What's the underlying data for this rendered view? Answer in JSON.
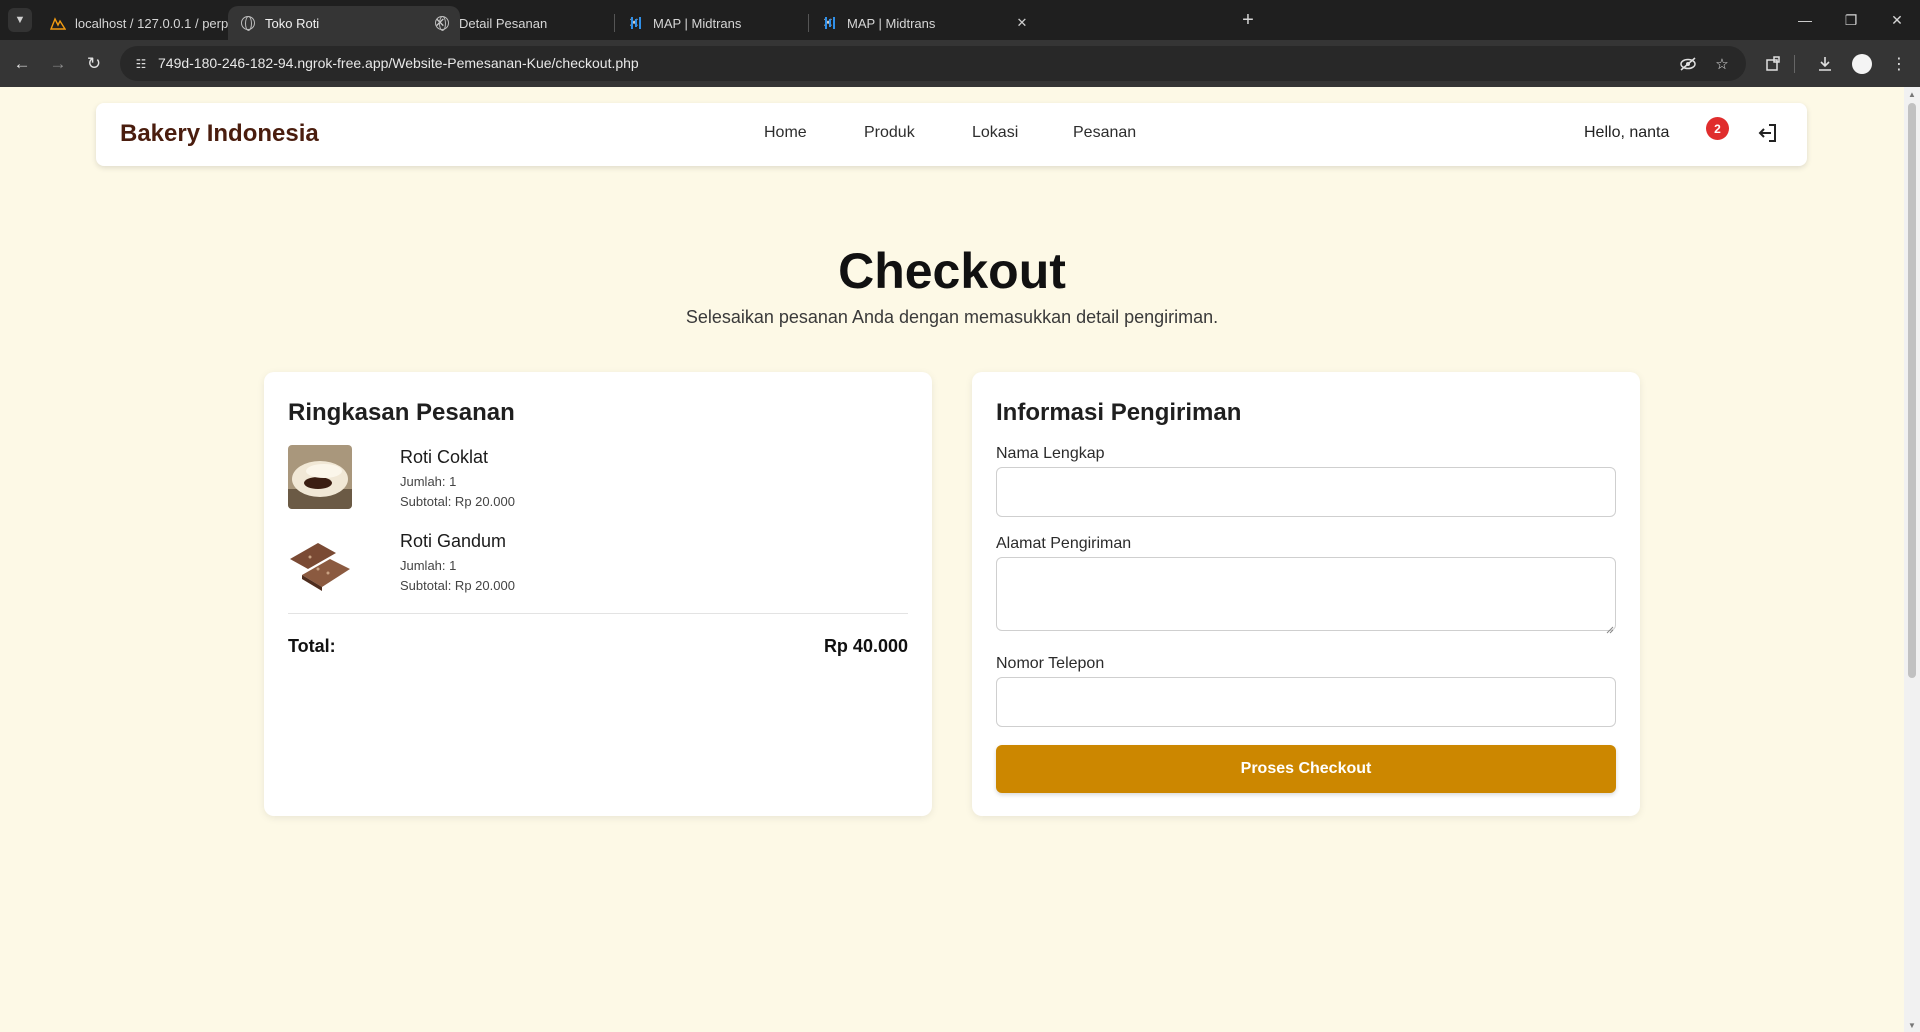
{
  "browser": {
    "tabs": [
      {
        "title": "localhost / 127.0.0.1 / perpustakaan",
        "icon": "phpmyadmin-icon",
        "active": false
      },
      {
        "title": "Toko Roti",
        "icon": "globe-icon",
        "active": true
      },
      {
        "title": "Detail Pesanan",
        "icon": "globe-icon",
        "active": false
      },
      {
        "title": "MAP | Midtrans",
        "icon": "midtrans-icon",
        "active": false
      },
      {
        "title": "MAP | Midtrans",
        "icon": "midtrans-icon",
        "active": false
      }
    ],
    "url": "749d-180-246-182-94.ngrok-free.app/Website-Pemesanan-Kue/checkout.php"
  },
  "site": {
    "brand": "Bakery Indonesia",
    "nav": [
      "Home",
      "Produk",
      "Lokasi",
      "Pesanan"
    ],
    "greeting": "Hello, nanta",
    "cart_count": "2"
  },
  "page": {
    "title": "Checkout",
    "subtitle": "Selesaikan pesanan Anda dengan memasukkan detail pengiriman."
  },
  "summary": {
    "title": "Ringkasan Pesanan",
    "items": [
      {
        "name": "Roti Coklat",
        "qty": "Jumlah: 1",
        "subtotal": "Subtotal: Rp 20.000",
        "image": "chocolate-bun"
      },
      {
        "name": "Roti Gandum",
        "qty": "Jumlah: 1",
        "subtotal": "Subtotal: Rp 20.000",
        "image": "wheat-bread"
      }
    ],
    "total_label": "Total:",
    "total_value": "Rp 40.000"
  },
  "shipping": {
    "title": "Informasi Pengiriman",
    "name_label": "Nama Lengkap",
    "name_value": "",
    "address_label": "Alamat Pengiriman",
    "address_value": "",
    "phone_label": "Nomor Telepon",
    "phone_value": "",
    "submit_label": "Proses Checkout"
  },
  "colors": {
    "page_bg": "#fdf9e6",
    "brand": "#4a1d0e",
    "accent": "#cc8700",
    "badge": "#e02d2d"
  }
}
